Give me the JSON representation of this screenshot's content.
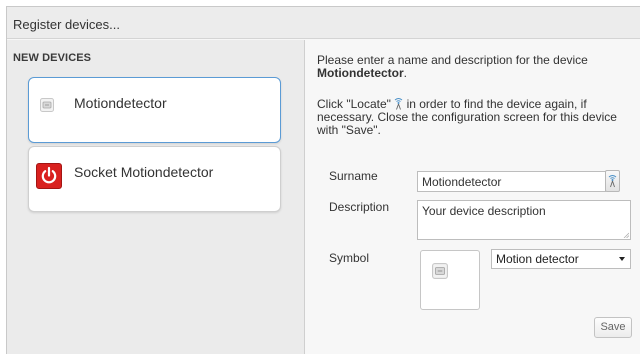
{
  "dialog": {
    "title": "Register devices..."
  },
  "sidebar": {
    "section_title": "NEW DEVICES",
    "devices": [
      {
        "label": "Motiondetector",
        "icon": "motion-sensor-icon",
        "selected": true
      },
      {
        "label": "Socket Motiondetector",
        "icon": "power-icon",
        "selected": false
      }
    ]
  },
  "config": {
    "intro": "Please enter a name and description for the device",
    "device_name": "Motiondetector",
    "intro_end": ".",
    "locate_before": "Click \"Locate\"",
    "locate_after": " in order to find the device again, if necessary. Close the configuration screen for this device with \"Save\".",
    "surname_label": "Surname",
    "surname_value": "Motiondetector",
    "description_label": "Description",
    "description_value": "Your device description",
    "symbol_label": "Symbol",
    "symbol_selected": "Motion detector",
    "save_label": "Save"
  },
  "colors": {
    "selected_border": "#5b9bd5",
    "power_red": "#d9211f",
    "locate_blue": "#4a90c8"
  }
}
